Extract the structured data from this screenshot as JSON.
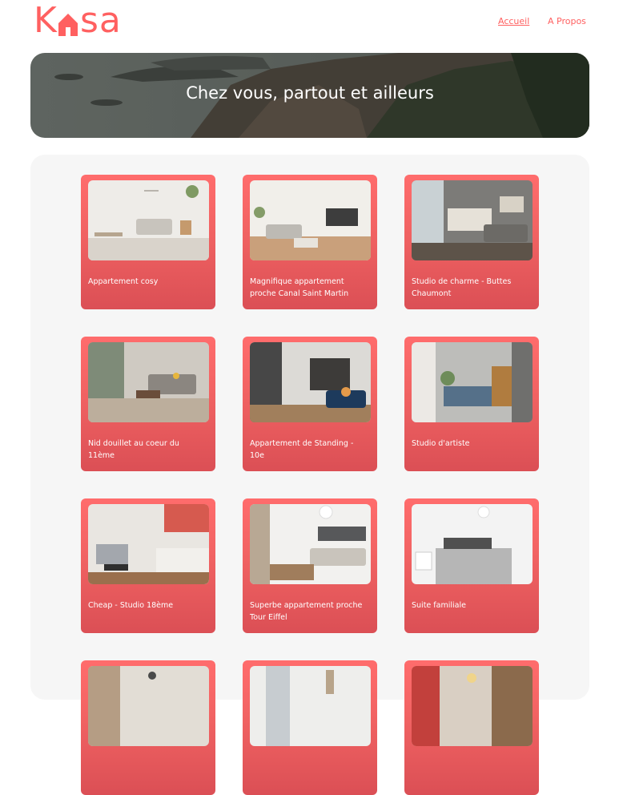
{
  "logo": {
    "left": "K",
    "right": "sa"
  },
  "nav": {
    "home": "Accueil",
    "about": "A Propos"
  },
  "banner": {
    "title": "Chez vous, partout et ailleurs"
  },
  "listings": [
    {
      "title": "Appartement cosy"
    },
    {
      "title": "Magnifique appartement proche Canal Saint Martin"
    },
    {
      "title": "Studio de charme - Buttes Chaumont"
    },
    {
      "title": "Nid douillet au coeur du 11ème"
    },
    {
      "title": "Appartement de Standing - 10e"
    },
    {
      "title": "Studio d'artiste"
    },
    {
      "title": "Cheap - Studio 18ème"
    },
    {
      "title": "Superbe appartement proche Tour Eiffel"
    },
    {
      "title": "Suite familiale"
    },
    {
      "title": ""
    },
    {
      "title": ""
    },
    {
      "title": ""
    }
  ],
  "colors": {
    "brand": "#ff6060",
    "gallery_bg": "#f6f6f6",
    "card_top": "#ff6c6c",
    "card_bottom": "#db4f55"
  }
}
